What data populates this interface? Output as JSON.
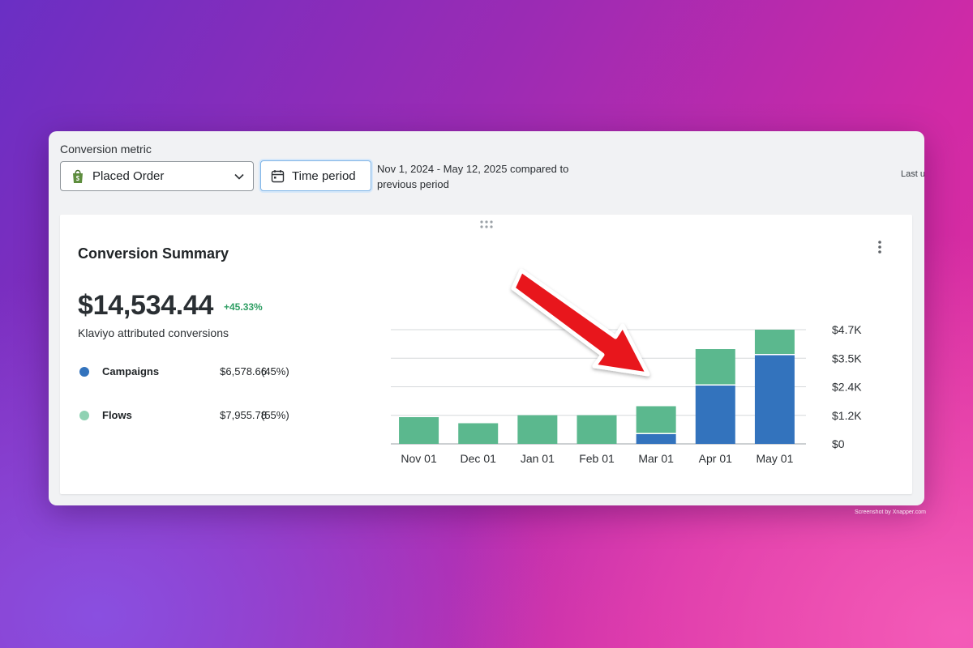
{
  "header": {
    "metric_label": "Conversion metric",
    "metric_value": "Placed Order",
    "time_button": "Time period",
    "date_range": "Nov 1, 2024 - May 12, 2025 compared to previous period",
    "last_updated_partial": "Last u"
  },
  "card": {
    "title": "Conversion Summary",
    "total": "$14,534.44",
    "delta": "+45.33%",
    "subtitle": "Klaviyo attributed conversions",
    "legend": [
      {
        "name": "Campaigns",
        "amount": "$6,578.66",
        "pct": "(45%)",
        "color": "#3373bd"
      },
      {
        "name": "Flows",
        "amount": "$7,955.78",
        "pct": "(55%)",
        "color": "#8fd2b3"
      }
    ]
  },
  "colors": {
    "campaigns_bar": "#3373bd",
    "flows_bar": "#5bb88e",
    "delta_green": "#2e9e63",
    "arrow": "#e8141c"
  },
  "icons": {
    "metric": "shopify-bag-icon",
    "time": "calendar-icon",
    "chevron": "chevron-down-icon",
    "menu": "kebab-menu-icon",
    "drag": "drag-handle-icon"
  },
  "chart_data": {
    "type": "bar",
    "stacked": true,
    "categories": [
      "Nov 01",
      "Dec 01",
      "Jan 01",
      "Feb 01",
      "Mar 01",
      "Apr 01",
      "May 01"
    ],
    "series": [
      {
        "name": "Campaigns",
        "values": [
          0,
          0,
          0,
          0,
          400,
          2400,
          3650
        ]
      },
      {
        "name": "Flows",
        "values": [
          1100,
          850,
          1180,
          1180,
          1150,
          1500,
          1050
        ]
      }
    ],
    "ytick_labels": [
      "$0",
      "$1.2K",
      "$2.4K",
      "$3.5K",
      "$4.7K"
    ],
    "yticks": [
      0,
      1175,
      2350,
      3525,
      4700
    ],
    "ylim": [
      0,
      4700
    ],
    "grid": true,
    "yaxis_position": "right"
  },
  "watermark": "Screenshot by Xnapper.com"
}
